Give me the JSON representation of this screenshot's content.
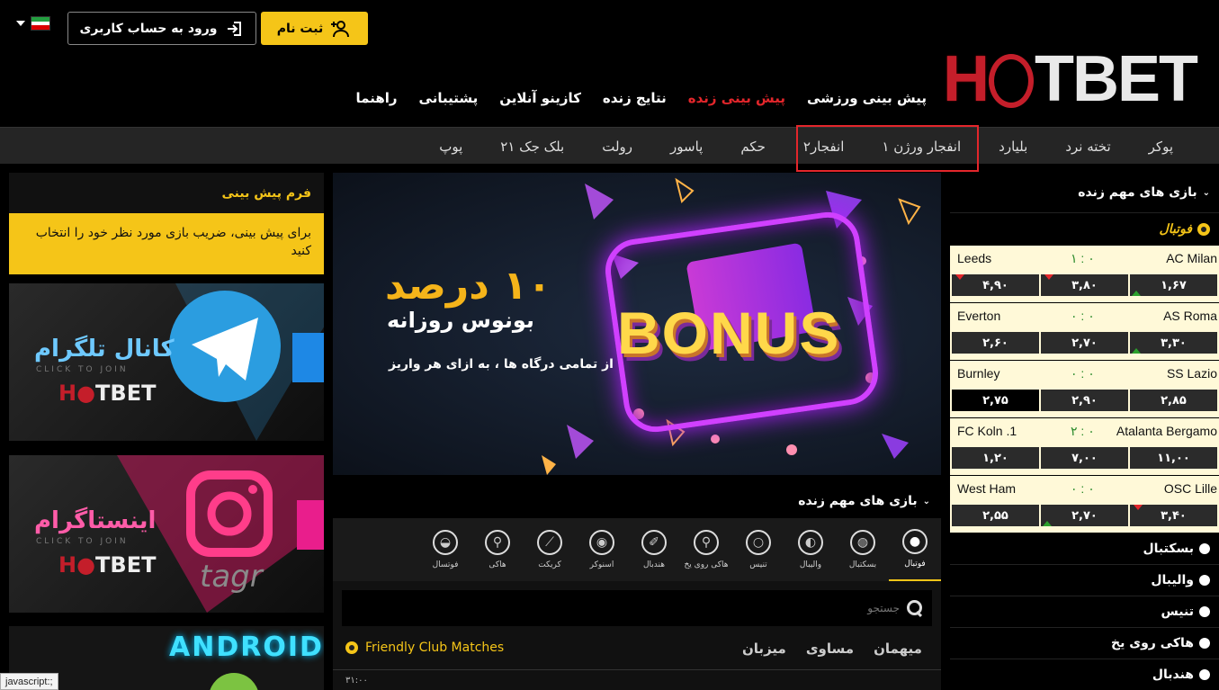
{
  "header": {
    "login_label": "ورود به حساب کاربری",
    "register_label": "ثبت نام",
    "logo_text_hot": "H",
    "logo_text_t": "T",
    "logo_text_bet": "BET",
    "nav": [
      "پیش بینی ورزشی",
      "پیش بینی زنده",
      "نتایج زنده",
      "کازینو آنلاین",
      "پشتیبانی",
      "راهنما"
    ]
  },
  "casino": [
    "پوکر",
    "تخته نرد",
    "بلیارد",
    "انفجار ورژن ۱",
    "انفجار۲",
    "حکم",
    "پاسور",
    "رولت",
    "بلک جک ۲۱",
    "پوپ"
  ],
  "form": {
    "title": "فرم پیش بینی",
    "text": "برای پیش بینی، ضریب بازی مورد نظر خود را انتخاب کنید"
  },
  "promos": {
    "telegram_title": "کانال تلگرام",
    "click": "CLICK TO JOIN",
    "instagram_title": "اینستاگرام",
    "android": "ANDROID",
    "instagram_side": "tagr"
  },
  "banner": {
    "title": "۱۰ درصد",
    "subtitle": "بونوس روزانه",
    "small": "از تمامی درگاه ها ، به ازای هر واریز",
    "bonus": "BONUS"
  },
  "live": {
    "title": "بازی های مهم زنده",
    "sports": [
      "فوتبال",
      "بسکتبال",
      "والیبال",
      "تنیس",
      "هاکی روی یخ",
      "هندبال",
      "اسنوکر",
      "کریکت",
      "هاکی",
      "فوتسال"
    ],
    "search_placeholder": "جستجو",
    "league": "Friendly Club Matches",
    "cols": [
      "میهمان",
      "مساوی",
      "میزبان"
    ],
    "first_time": "۳۱:۰۰"
  },
  "sidebar": {
    "title": "بازی های مهم زنده",
    "category": "فوتبال",
    "matches": [
      {
        "home": "AC Milan",
        "away": "Leeds",
        "score": "۱ : ۰",
        "odds": [
          "۱,۶۷",
          "۳,۸۰",
          "۴,۹۰"
        ]
      },
      {
        "home": "AS Roma",
        "away": "Everton",
        "score": "۰ : ۰",
        "odds": [
          "۳,۳۰",
          "۲,۷۰",
          "۲,۶۰"
        ]
      },
      {
        "home": "SS Lazio",
        "away": "Burnley",
        "score": "۰ : ۰",
        "odds": [
          "۲,۸۵",
          "۲,۹۰",
          "۲,۷۵"
        ]
      },
      {
        "home": "Atalanta Bergamo",
        "away": "FC Koln .1",
        "score": "۲ : ۰",
        "odds": [
          "۱۱,۰۰",
          "۷,۰۰",
          "۱,۲۰"
        ]
      },
      {
        "home": "OSC Lille",
        "away": "West Ham",
        "score": "۰ : ۰",
        "odds": [
          "۳,۴۰",
          "۲,۷۰",
          "۲,۵۵"
        ]
      }
    ],
    "sports": [
      "بسکتبال",
      "والیبال",
      "تنیس",
      "هاکی روی یخ",
      "هندبال"
    ]
  },
  "status": "javascript:;",
  "colors": {
    "accent": "#f5c518",
    "brand_red": "#c41e2a",
    "live_red": "#e3262b"
  }
}
